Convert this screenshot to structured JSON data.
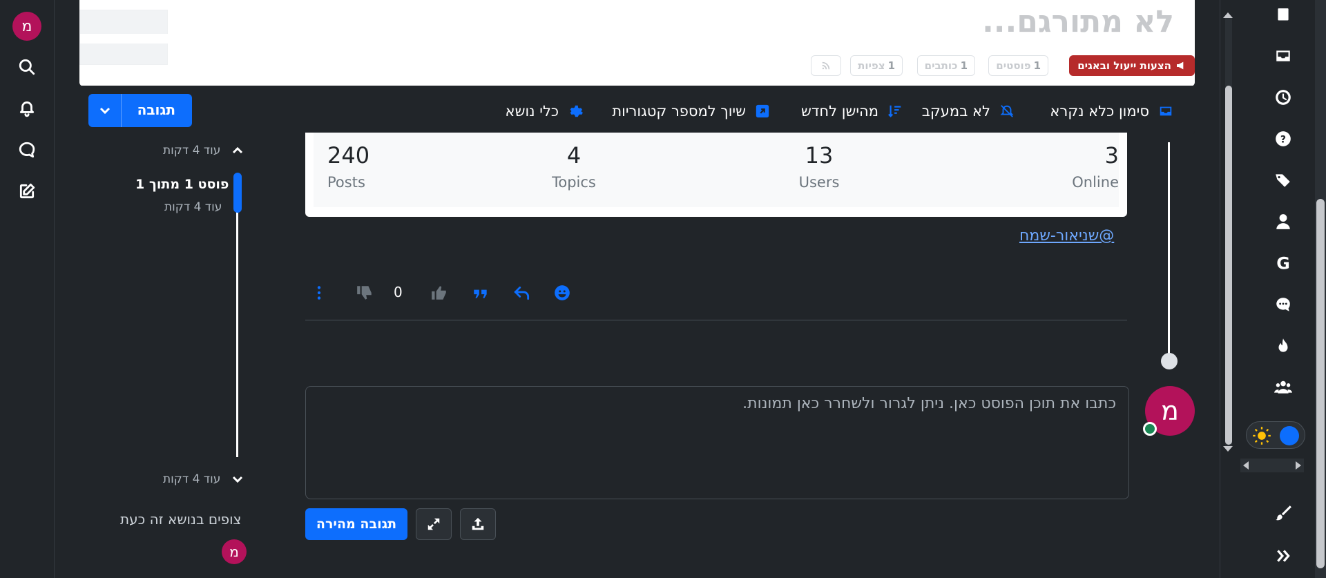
{
  "user": {
    "avatar_letter": "מ"
  },
  "header": {
    "title": "לא מתורגם...",
    "category_badge": "הצעות ייעול ובאגים",
    "stats": [
      {
        "num": "1",
        "label": "פוסטים"
      },
      {
        "num": "1",
        "label": "כותבים"
      },
      {
        "num": "1",
        "label": "צפיות"
      }
    ]
  },
  "toolbar": {
    "mark_unread": "סימון כלא נקרא",
    "not_watching": "לא במעקב",
    "sort_label": "מהישן לחדש",
    "crosspost": "שיוך למספר קטגוריות",
    "topic_tools": "כלי נושא",
    "reply_label": "תגובה"
  },
  "forum_stats": [
    {
      "num": "3",
      "label": "Online"
    },
    {
      "num": "13",
      "label": "Users"
    },
    {
      "num": "4",
      "label": "Topics"
    },
    {
      "num": "240",
      "label": "Posts"
    }
  ],
  "post": {
    "mention": "@שניאור-שמח",
    "votes": "0"
  },
  "composer": {
    "placeholder": "כתבו את תוכן הפוסט כאן. ניתן לגרור ולשחרר כאן תמונות.",
    "quick_reply": "תגובה מהירה"
  },
  "sidebar": {
    "time_top": "עוד 4 דקות",
    "post_index": "פוסט 1 מתוך 1",
    "post_time": "עוד 4 דקות",
    "time_bottom": "עוד 4 דקות",
    "watching_title": "צופים בנושא זה כעת"
  },
  "colors": {
    "accent": "#0d6efd",
    "avatar": "#b3125a",
    "category": "#b62b2b",
    "bg": "#212529"
  }
}
